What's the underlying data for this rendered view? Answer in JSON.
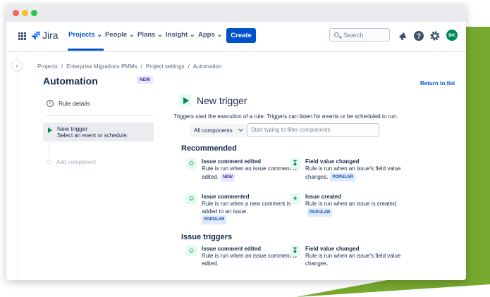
{
  "window": {
    "nav": {
      "logo_text": "Jira",
      "items": [
        "Projects",
        "People",
        "Plans",
        "Insight",
        "Apps"
      ],
      "create_label": "Create",
      "search_placeholder": "Search",
      "avatar_initials": "BK"
    }
  },
  "breadcrumb": [
    "Projects",
    "Enterprise Migrations PMMs",
    "Project settings",
    "Automation"
  ],
  "page": {
    "title": "Automation",
    "title_badge": "NEW",
    "return_link": "Return to list"
  },
  "sidebar": {
    "rule_details": "Rule details",
    "trigger_title": "New trigger",
    "trigger_subtitle": "Select an event or schedule.",
    "add_component": "Add component"
  },
  "main": {
    "title": "New trigger",
    "description": "Triggers start the execution of a rule. Triggers can listen for events or be scheduled to run.",
    "filter_select": "All components",
    "filter_placeholder": "Start typing to filter components",
    "recommended_heading": "Recommended",
    "issue_triggers_heading": "Issue triggers",
    "recommended": [
      {
        "icon": "comment-icon",
        "title": "Issue comment edited",
        "body": "Rule is run when an issue comment is edited.",
        "badge": "NEW"
      },
      {
        "icon": "field-change-icon",
        "title": "Field value changed",
        "body": "Rule is run when an issue's field value changes.",
        "badge": "POPULAR"
      },
      {
        "icon": "comment-icon",
        "title": "Issue commented",
        "body": "Rule is run when a new comment is added to an issue.",
        "badge": "POPULAR"
      },
      {
        "icon": "plus-icon",
        "title": "Issue created",
        "body": "Rule is run when an issue is created.",
        "badge": "POPULAR"
      }
    ],
    "issue_triggers": [
      {
        "icon": "comment-icon",
        "title": "Issue comment edited",
        "body": "Rule is run when an issue comment is edited."
      },
      {
        "icon": "field-change-icon",
        "title": "Field value changed",
        "body": "Rule is run when an issue's field value changes."
      }
    ]
  },
  "colors": {
    "accent_blue": "#0052cc",
    "trigger_green": "#00875a",
    "background_green": "#76a82e",
    "avatar_green": "#00875a"
  }
}
